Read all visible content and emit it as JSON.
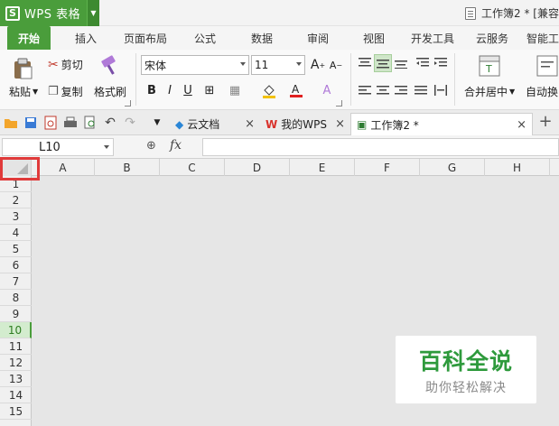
{
  "app": {
    "name": "WPS 表格",
    "logo_glyph": "S",
    "accent": "#4a9d3b"
  },
  "window": {
    "title": "工作簿2 * [兼容"
  },
  "ribbon_tabs": [
    {
      "label": "开始",
      "active": true
    },
    {
      "label": "插入"
    },
    {
      "label": "页面布局"
    },
    {
      "label": "公式"
    },
    {
      "label": "数据"
    },
    {
      "label": "审阅"
    },
    {
      "label": "视图"
    },
    {
      "label": "开发工具"
    },
    {
      "label": "云服务"
    },
    {
      "label": "智能工"
    }
  ],
  "ribbon": {
    "paste_label": "粘贴",
    "cut_label": "剪切",
    "copy_label": "复制",
    "format_painter_label": "格式刷",
    "font_name": "宋体",
    "font_size": "11",
    "merge_center_label": "合并居中",
    "auto_wrap_label": "自动换"
  },
  "doc_tabs": [
    {
      "label": "云文档"
    },
    {
      "label": "我的WPS"
    },
    {
      "label": "工作簿2 *",
      "active": true
    }
  ],
  "formula_bar": {
    "cell_ref": "L10",
    "fx_label": "fx",
    "value": ""
  },
  "columns": [
    "A",
    "B",
    "C",
    "D",
    "E",
    "F",
    "G",
    "H"
  ],
  "rows": [
    "1",
    "2",
    "3",
    "4",
    "5",
    "6",
    "7",
    "8",
    "9",
    "10",
    "11",
    "12",
    "13",
    "14",
    "15"
  ],
  "active_row": "10",
  "watermark": {
    "title": "百科全说",
    "subtitle": "助你轻松解决"
  }
}
